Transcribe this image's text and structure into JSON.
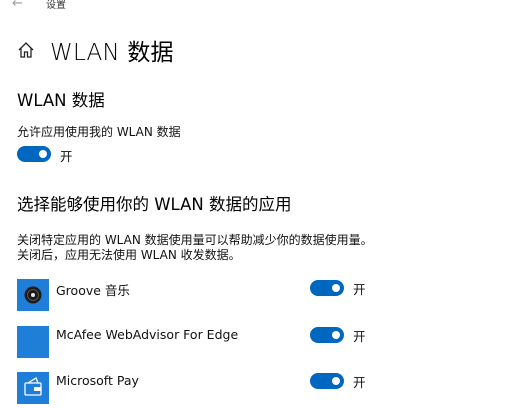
{
  "window": {
    "title": "设置"
  },
  "header": {
    "title": "WLAN 数据"
  },
  "section_wlan": {
    "title": "WLAN 数据",
    "allow_label": "允许应用使用我的 WLAN 数据",
    "toggle_state": "开",
    "toggle_on": true
  },
  "section_apps": {
    "title": "选择能够使用你的 WLAN 数据的应用",
    "description_line1": "关闭特定应用的 WLAN 数据使用量可以帮助减少你的数据使用量。",
    "description_line2": "关闭后，应用无法使用 WLAN 收发数据。",
    "apps": [
      {
        "name": "Groove 音乐",
        "toggle_state": "开",
        "toggle_on": true,
        "icon": "groove-music-icon"
      },
      {
        "name": "McAfee WebAdvisor For Edge",
        "toggle_state": "开",
        "toggle_on": true,
        "icon": "mcafee-icon"
      },
      {
        "name": "Microsoft Pay",
        "toggle_state": "开",
        "toggle_on": true,
        "icon": "microsoft-pay-icon"
      }
    ]
  },
  "colors": {
    "accent": "#0067c0",
    "app_tile": "#1f7ed8"
  }
}
